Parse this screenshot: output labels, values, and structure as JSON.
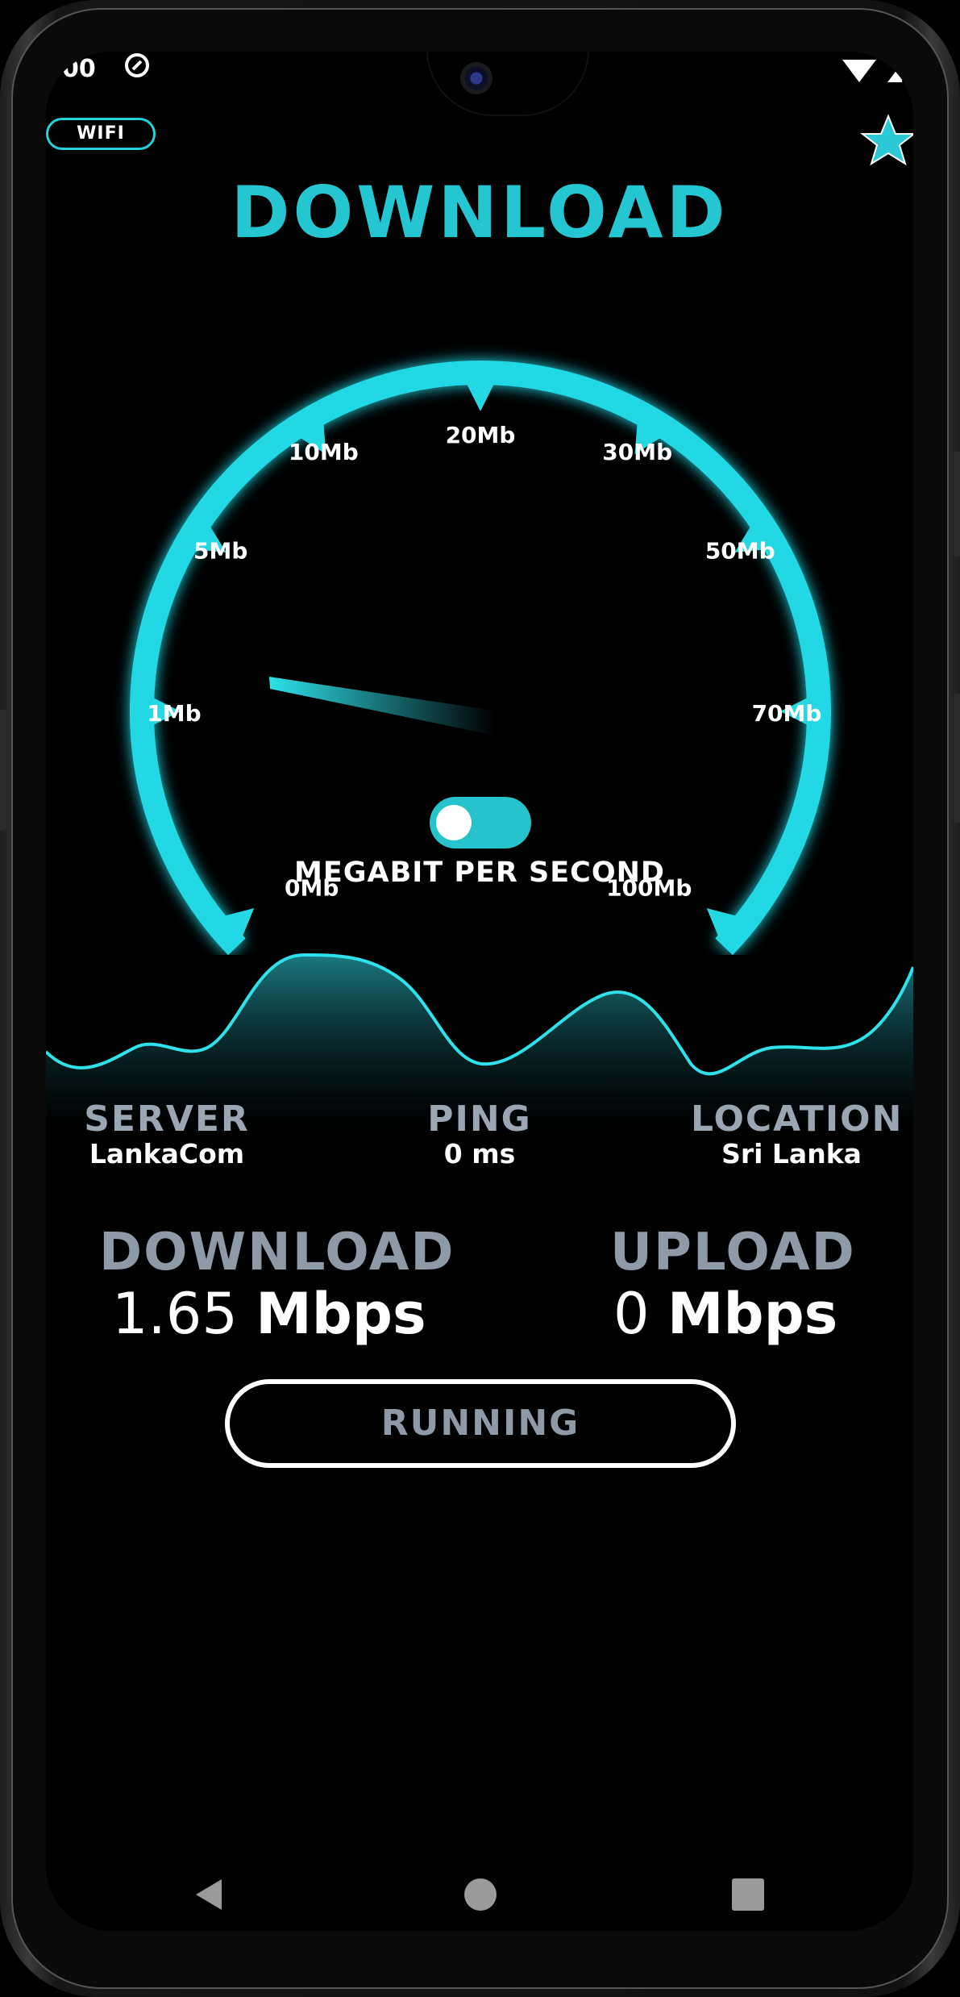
{
  "status_bar": {
    "time_fragment": "00"
  },
  "top": {
    "connection_chip": "WIFI"
  },
  "title": "DOWNLOAD",
  "gauge": {
    "ticks": [
      "0Mb",
      "1Mb",
      "5Mb",
      "10Mb",
      "20Mb",
      "30Mb",
      "50Mb",
      "70Mb",
      "100Mb"
    ],
    "accent": "#24d8e4"
  },
  "unit_label": "MEGABIT PER SECOND",
  "info": {
    "server_label": "SERVER",
    "server_value": "LankaCom",
    "ping_label": "PING",
    "ping_value": "0 ms",
    "location_label": "LOCATION",
    "location_value": "Sri Lanka"
  },
  "results": {
    "download_label": "DOWNLOAD",
    "download_number": "1.65",
    "download_unit": "Mbps",
    "upload_label": "UPLOAD",
    "upload_number": "0",
    "upload_unit": "Mbps"
  },
  "run_button": "RUNNING",
  "icons": [
    "q-circle-icon",
    "wifi-signal-icon",
    "star-icon",
    "back-icon",
    "home-icon",
    "recents-icon"
  ]
}
